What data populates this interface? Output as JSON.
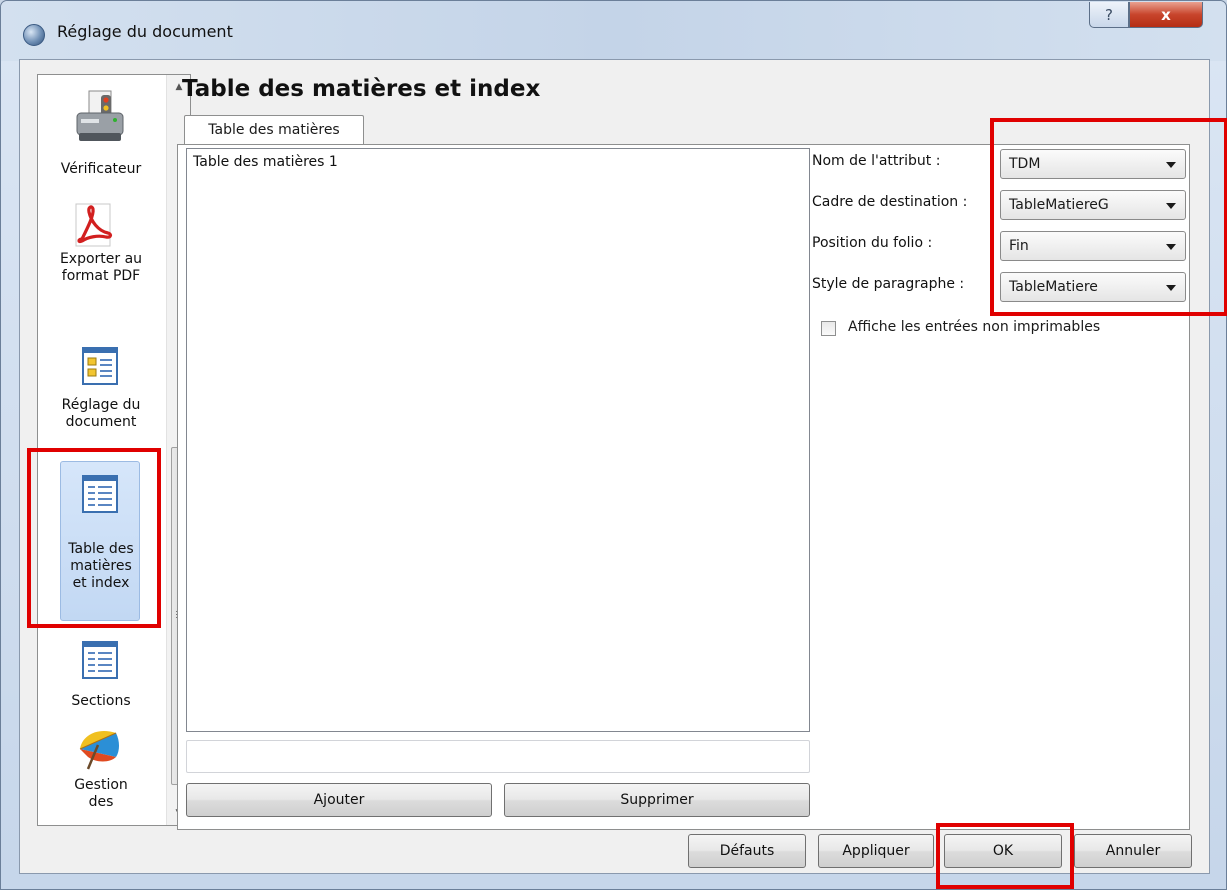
{
  "window": {
    "title": "Réglage du document",
    "help_label": "?",
    "close_label": "x"
  },
  "sidebar": {
    "items": [
      {
        "label": "Vérificateur",
        "icon": "printer-check-icon"
      },
      {
        "label": "Exporter au format PDF",
        "icon": "pdf-icon"
      },
      {
        "label": "Réglage du document",
        "icon": "document-layout-icon"
      },
      {
        "label": "Table des matières et index",
        "icon": "table-of-contents-icon",
        "selected": true
      },
      {
        "label": "Sections",
        "icon": "sections-icon"
      },
      {
        "label": "Gestion des",
        "icon": "umbrella-icon"
      }
    ]
  },
  "page": {
    "title": "Table des matières et index",
    "tab_label": "Table des matières",
    "list_items": [
      "Table des matières 1"
    ],
    "new_entry_value": "",
    "add_label": "Ajouter",
    "remove_label": "Supprimer"
  },
  "settings": {
    "attribute_label": "Nom de l'attribut :",
    "attribute_value": "TDM",
    "frame_label": "Cadre de destination :",
    "frame_value": "TableMatiereG",
    "folio_label": "Position du folio :",
    "folio_value": "Fin",
    "style_label": "Style de paragraphe :",
    "style_value": "TableMatiere",
    "nonprint_label": "Affiche les entrées non imprimables",
    "nonprint_checked": false
  },
  "footer": {
    "defaults_label": "Défauts",
    "apply_label": "Appliquer",
    "ok_label": "OK",
    "cancel_label": "Annuler"
  },
  "annotation_color": "#e00000"
}
